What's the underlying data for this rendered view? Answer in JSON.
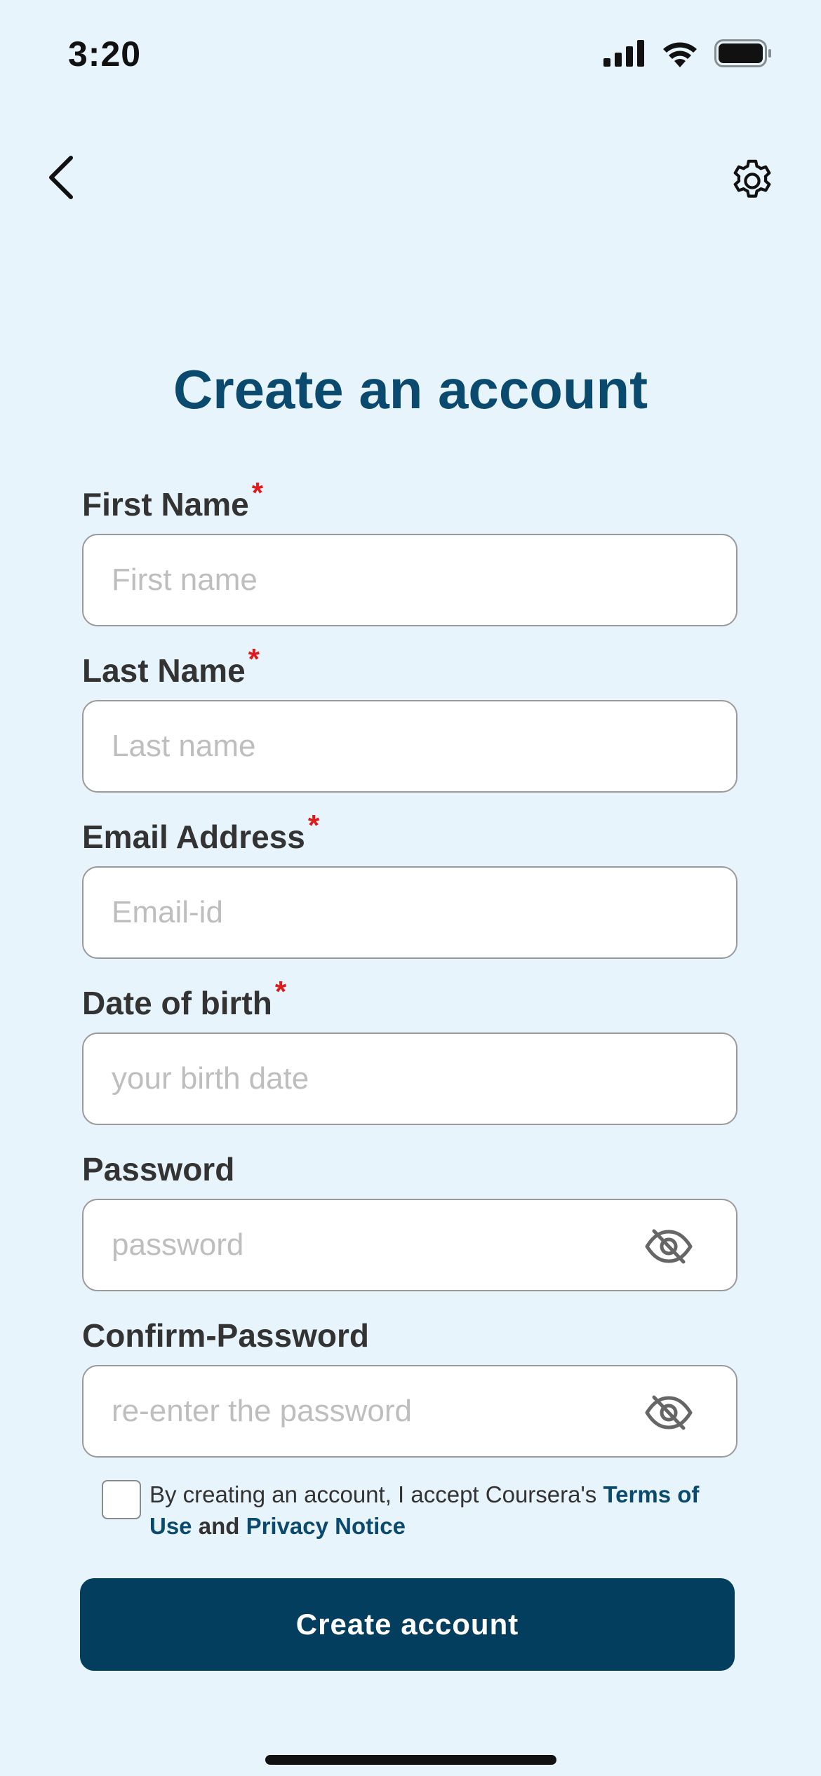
{
  "status_bar": {
    "time": "3:20",
    "icons": [
      "signal-icon",
      "wifi-icon",
      "battery-icon"
    ]
  },
  "nav": {
    "back_icon": "chevron-left-icon",
    "settings_icon": "gear-icon"
  },
  "title": "Create an account",
  "fields": [
    {
      "label": "First Name",
      "required": "*",
      "placeholder": "First name",
      "value": ""
    },
    {
      "label": "Last Name",
      "required": "*",
      "placeholder": "Last name",
      "value": ""
    },
    {
      "label": "Email Address",
      "required": "*",
      "placeholder": "Email-id",
      "value": ""
    },
    {
      "label": "Date of birth",
      "required": "*",
      "placeholder": "your birth date",
      "value": ""
    },
    {
      "label": "Password",
      "placeholder": "password",
      "value": "",
      "icon": "eye-off-icon"
    },
    {
      "label": "Confirm-Password",
      "placeholder": "re-enter the password",
      "value": "",
      "icon": "eye-off-icon"
    }
  ],
  "terms": {
    "checked": false,
    "prefix": "By creating an account, I accept Coursera's ",
    "terms_link": "Terms of Use",
    "conjunction": " and ",
    "privacy_link": "Privacy Notice"
  },
  "submit_label": "Create account",
  "colors": {
    "background": "#E8F4FC",
    "accent": "#0A4A6E",
    "button": "#043E5E",
    "required": "#E0191B",
    "placeholder": "#BEBEBE"
  }
}
